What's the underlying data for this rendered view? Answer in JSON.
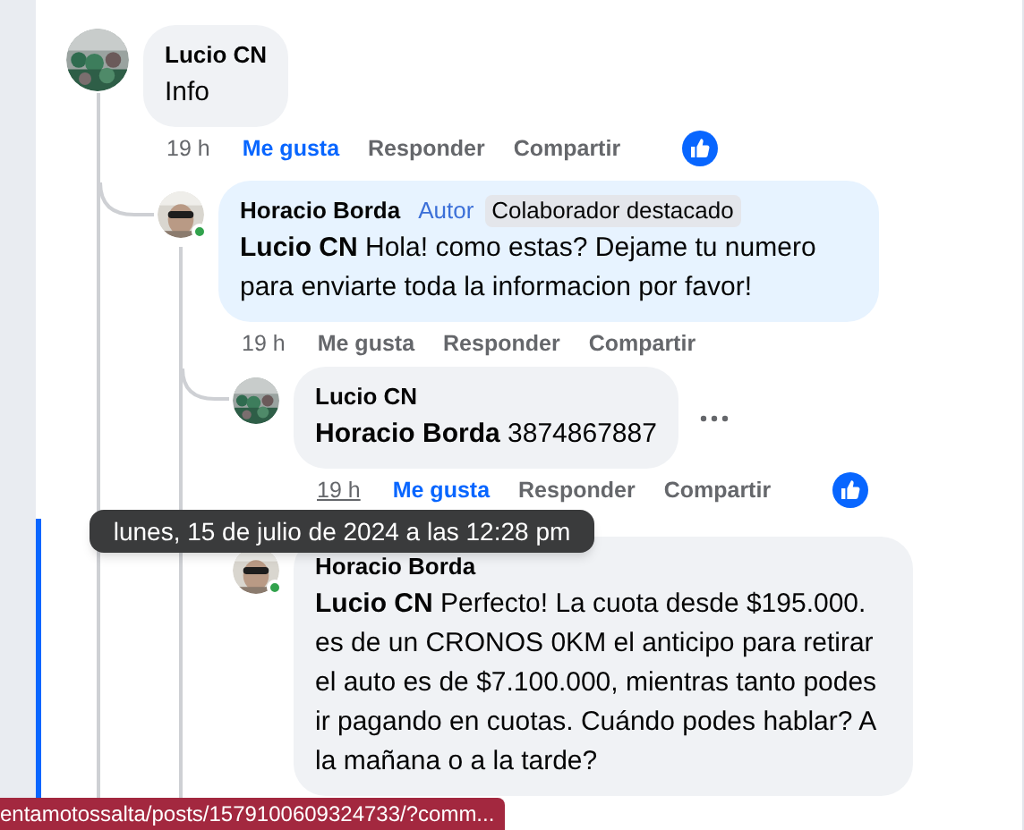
{
  "comments": [
    {
      "kind": "reply",
      "author": "Lucio CN",
      "text": "Info",
      "online": false,
      "time": "19 h",
      "time_hovered": false,
      "actions": [
        {
          "label": "Me gusta",
          "selected": true
        },
        {
          "label": "Responder",
          "selected": false
        },
        {
          "label": "Compartir",
          "selected": false
        }
      ],
      "reaction": true,
      "children": [
        {
          "kind": "author",
          "author": "Horacio Borda",
          "author_label": "Autor",
          "badge": "Colaborador destacado",
          "text": "**Lucio CN** Hola! como estas? Dejame tu numero para enviarte toda la informacion por favor!",
          "online": true,
          "time": "19 h",
          "time_hovered": false,
          "actions": [
            {
              "label": "Me gusta",
              "selected": false
            },
            {
              "label": "Responder",
              "selected": false
            },
            {
              "label": "Compartir",
              "selected": false
            }
          ],
          "reaction": false,
          "children": [
            {
              "kind": "reply",
              "author": "Lucio CN",
              "text": "**Horacio Borda** 3874867887",
              "online": false,
              "more": true,
              "time": "19 h",
              "time_hovered": true,
              "tooltip": "lunes, 15 de julio de 2024 a las 12:28 pm",
              "actions": [
                {
                  "label": "Me gusta",
                  "selected": true
                },
                {
                  "label": "Responder",
                  "selected": false
                },
                {
                  "label": "Compartir",
                  "selected": false
                }
              ],
              "reaction": true
            },
            {
              "kind": "reply",
              "author": "Horacio Borda",
              "text": "**Lucio CN** Perfecto! La cuota desde $195.000. es de un CRONOS 0KM el anticipo para retirar el auto es de $7.100.000, mientras tanto podes ir pagando en cuotas. Cuándo podes hablar? A la mañana o a la tarde?",
              "online": true,
              "more": false
            }
          ]
        }
      ]
    }
  ],
  "status_bar": "entamotossalta/posts/1579100609324733/?comm..."
}
